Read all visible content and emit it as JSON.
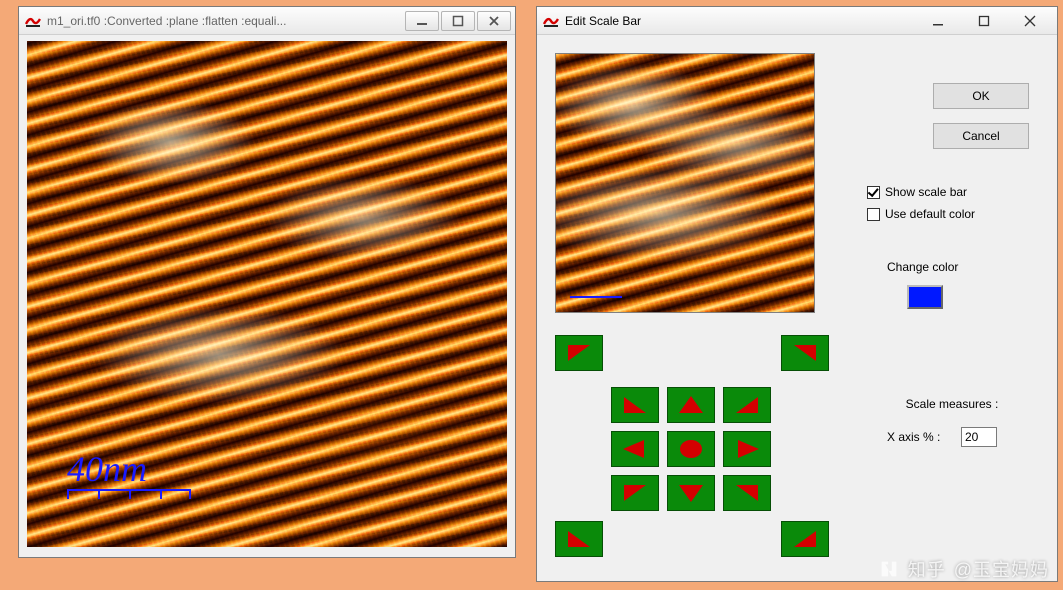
{
  "image_window": {
    "title": "m1_ori.tf0 :Converted :plane :flatten :equali...",
    "scale_bar_label": "40nm"
  },
  "dialog": {
    "title": "Edit Scale Bar",
    "ok_label": "OK",
    "cancel_label": "Cancel",
    "show_scale_bar_label": "Show scale bar",
    "show_scale_bar_checked": true,
    "use_default_color_label": "Use default color",
    "use_default_color_checked": false,
    "change_color_label": "Change color",
    "color_hex": "#0018ff",
    "measures_label": "Scale measures :",
    "x_axis_label": "X axis % :",
    "x_axis_value": "20"
  },
  "watermark": {
    "site": "知乎",
    "at": "@玉宝妈妈"
  }
}
